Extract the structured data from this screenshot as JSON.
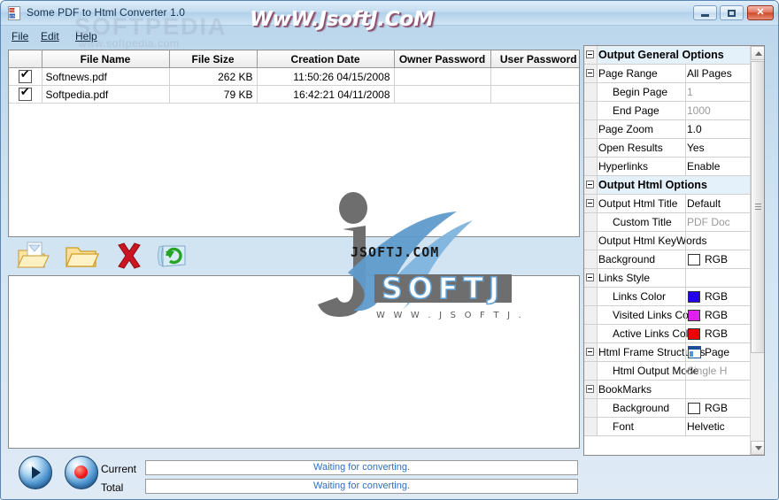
{
  "window": {
    "title": "Some PDF to Html Converter 1.0",
    "app_icon": "pdf-html-icon",
    "buttons": {
      "minimize": "minimize-button",
      "maximize": "maximize-button",
      "close": "close-button",
      "close_glyph": "✕"
    }
  },
  "menubar": {
    "items": [
      {
        "label": "File",
        "accel": "F"
      },
      {
        "label": "Edit",
        "accel": "E"
      },
      {
        "label": "Help",
        "accel": "H"
      }
    ]
  },
  "watermarks": {
    "header": "WwW.JsoftJ.CoM",
    "softpedia": "SOFTPEDIA",
    "softpedia_url": "www.softpedia.com",
    "center_text": "JSOFTJ.COM",
    "logo_text": "SOFTJ",
    "logo_url": "W W W . J S O F T J . C O M"
  },
  "filelist": {
    "columns": [
      "",
      "File Name",
      "File Size",
      "Creation Date",
      "Owner Password",
      "User Password"
    ],
    "rows": [
      {
        "checked": true,
        "check_glyph": "✔",
        "name": "Softnews.pdf",
        "size": "262 KB",
        "date": "11:50:26 04/15/2008",
        "owner_password": "",
        "user_password": ""
      },
      {
        "checked": true,
        "check_glyph": "✔",
        "name": "Softpedia.pdf",
        "size": "79 KB",
        "date": "16:42:21 04/11/2008",
        "owner_password": "",
        "user_password": ""
      }
    ]
  },
  "toolbar": {
    "buttons": [
      {
        "name": "add-files-button",
        "icon": "open-folder-with-document-icon"
      },
      {
        "name": "add-folder-button",
        "icon": "folder-icon"
      },
      {
        "name": "remove-button",
        "icon": "red-x-icon"
      },
      {
        "name": "refresh-button",
        "icon": "refresh-icon"
      }
    ]
  },
  "status": {
    "start_button": "start-button",
    "stop_button": "stop-button",
    "current_label": "Current",
    "total_label": "Total",
    "current_status": "Waiting for converting.",
    "total_status": "Waiting for converting.",
    "current_percent": 0,
    "total_percent": 0
  },
  "properties": {
    "rows": [
      {
        "kind": "category",
        "expander": true,
        "indent": 0,
        "name": "Output General Options",
        "value": ""
      },
      {
        "kind": "prop",
        "expander": true,
        "indent": 0,
        "name": "Page Range",
        "value": "All Pages"
      },
      {
        "kind": "prop",
        "expander": false,
        "indent": 1,
        "name": "Begin Page",
        "value": "1",
        "dim": true
      },
      {
        "kind": "prop",
        "expander": false,
        "indent": 1,
        "name": "End Page",
        "value": "1000",
        "dim": true
      },
      {
        "kind": "prop",
        "expander": false,
        "indent": 0,
        "name": "Page Zoom",
        "value": "1.0"
      },
      {
        "kind": "prop",
        "expander": false,
        "indent": 0,
        "name": "Open Results",
        "value": "Yes"
      },
      {
        "kind": "prop",
        "expander": false,
        "indent": 0,
        "name": "Hyperlinks",
        "value": "Enable"
      },
      {
        "kind": "category",
        "expander": true,
        "indent": 0,
        "name": "Output Html Options",
        "value": ""
      },
      {
        "kind": "prop",
        "expander": true,
        "indent": 0,
        "name": "Output Html Title",
        "value": "Default"
      },
      {
        "kind": "prop",
        "expander": false,
        "indent": 1,
        "name": "Custom Title",
        "value": "PDF Doc",
        "dim": true
      },
      {
        "kind": "prop",
        "expander": false,
        "indent": 0,
        "name": "Output Html KeyWords",
        "value": ""
      },
      {
        "kind": "prop",
        "expander": false,
        "indent": 0,
        "name": "Background",
        "value": "RGB",
        "swatch": "#ffffff"
      },
      {
        "kind": "prop",
        "expander": true,
        "indent": 0,
        "name": "Links Style",
        "value": ""
      },
      {
        "kind": "prop",
        "expander": false,
        "indent": 1,
        "name": "Links Color",
        "value": "RGB",
        "swatch": "#2200ee"
      },
      {
        "kind": "prop",
        "expander": false,
        "indent": 1,
        "name": "Visited Links Color",
        "value": "RGB",
        "swatch": "#e020ee"
      },
      {
        "kind": "prop",
        "expander": false,
        "indent": 1,
        "name": "Active Links Color",
        "value": "RGB",
        "swatch": "#ee0000"
      },
      {
        "kind": "prop",
        "expander": true,
        "indent": 0,
        "name": "Html Frame Structures",
        "value": "Page",
        "frameicon": true
      },
      {
        "kind": "prop",
        "expander": false,
        "indent": 1,
        "name": "Html Output Mode",
        "value": "Single H",
        "dim": true
      },
      {
        "kind": "prop",
        "expander": true,
        "indent": 0,
        "name": "BookMarks",
        "value": ""
      },
      {
        "kind": "prop",
        "expander": false,
        "indent": 1,
        "name": "Background",
        "value": "RGB",
        "swatch": "#ffffff"
      },
      {
        "kind": "prop",
        "expander": false,
        "indent": 1,
        "name": "Font",
        "value": "Helvetic"
      }
    ],
    "scrollbar": {
      "up": "▲",
      "down": "▼"
    }
  }
}
